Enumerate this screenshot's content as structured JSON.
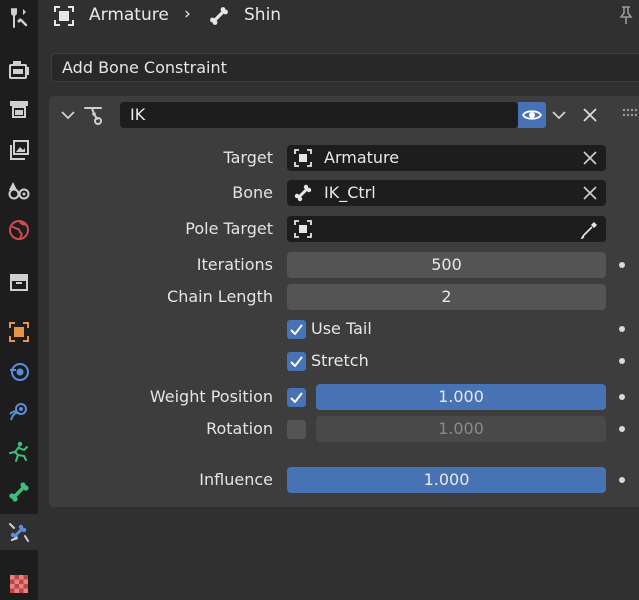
{
  "breadcrumb": {
    "object_label": "Armature",
    "separator": "›",
    "bone_label": "Shin"
  },
  "tabs": [
    {
      "name": "tool",
      "icon": "tool-icon",
      "active": false
    },
    {
      "name": "render",
      "icon": "render-icon",
      "active": false
    },
    {
      "name": "output",
      "icon": "output-icon",
      "active": false
    },
    {
      "name": "view-layer",
      "icon": "view-layer-icon",
      "active": false
    },
    {
      "name": "scene",
      "icon": "scene-icon",
      "active": false
    },
    {
      "name": "world",
      "icon": "world-icon",
      "active": false
    },
    {
      "name": "collection",
      "icon": "collection-icon",
      "active": false
    },
    {
      "name": "object",
      "icon": "object-icon",
      "active": false
    },
    {
      "name": "modifiers",
      "icon": "modifiers-icon",
      "active": false
    },
    {
      "name": "physics",
      "icon": "physics-icon",
      "active": false
    },
    {
      "name": "object-data",
      "icon": "armature-data-icon",
      "active": false
    },
    {
      "name": "bone",
      "icon": "bone-icon",
      "active": false
    },
    {
      "name": "bone-constraints",
      "icon": "bone-constraint-icon",
      "active": true
    },
    {
      "name": "texture",
      "icon": "texture-icon",
      "active": false
    }
  ],
  "add_constraint_label": "Add Bone Constraint",
  "constraint": {
    "name": "IK",
    "target_label": "Target",
    "target_value": "Armature",
    "bone_label": "Bone",
    "bone_value": "IK_Ctrl",
    "pole_target_label": "Pole Target",
    "pole_target_value": "",
    "iterations_label": "Iterations",
    "iterations_value": "500",
    "chain_length_label": "Chain Length",
    "chain_length_value": "2",
    "use_tail_label": "Use Tail",
    "use_tail_checked": true,
    "stretch_label": "Stretch",
    "stretch_checked": true,
    "weight_position_label": "Weight Position",
    "weight_position_checked": true,
    "weight_position_value": "1.000",
    "rotation_label": "Rotation",
    "rotation_checked": false,
    "rotation_value": "1.000",
    "influence_label": "Influence",
    "influence_value": "1.000"
  },
  "colors": {
    "accent": "#4772b3",
    "background": "#303030",
    "panel": "#3d3d3d",
    "field": "#1d1d1d",
    "number_field": "#545454"
  }
}
